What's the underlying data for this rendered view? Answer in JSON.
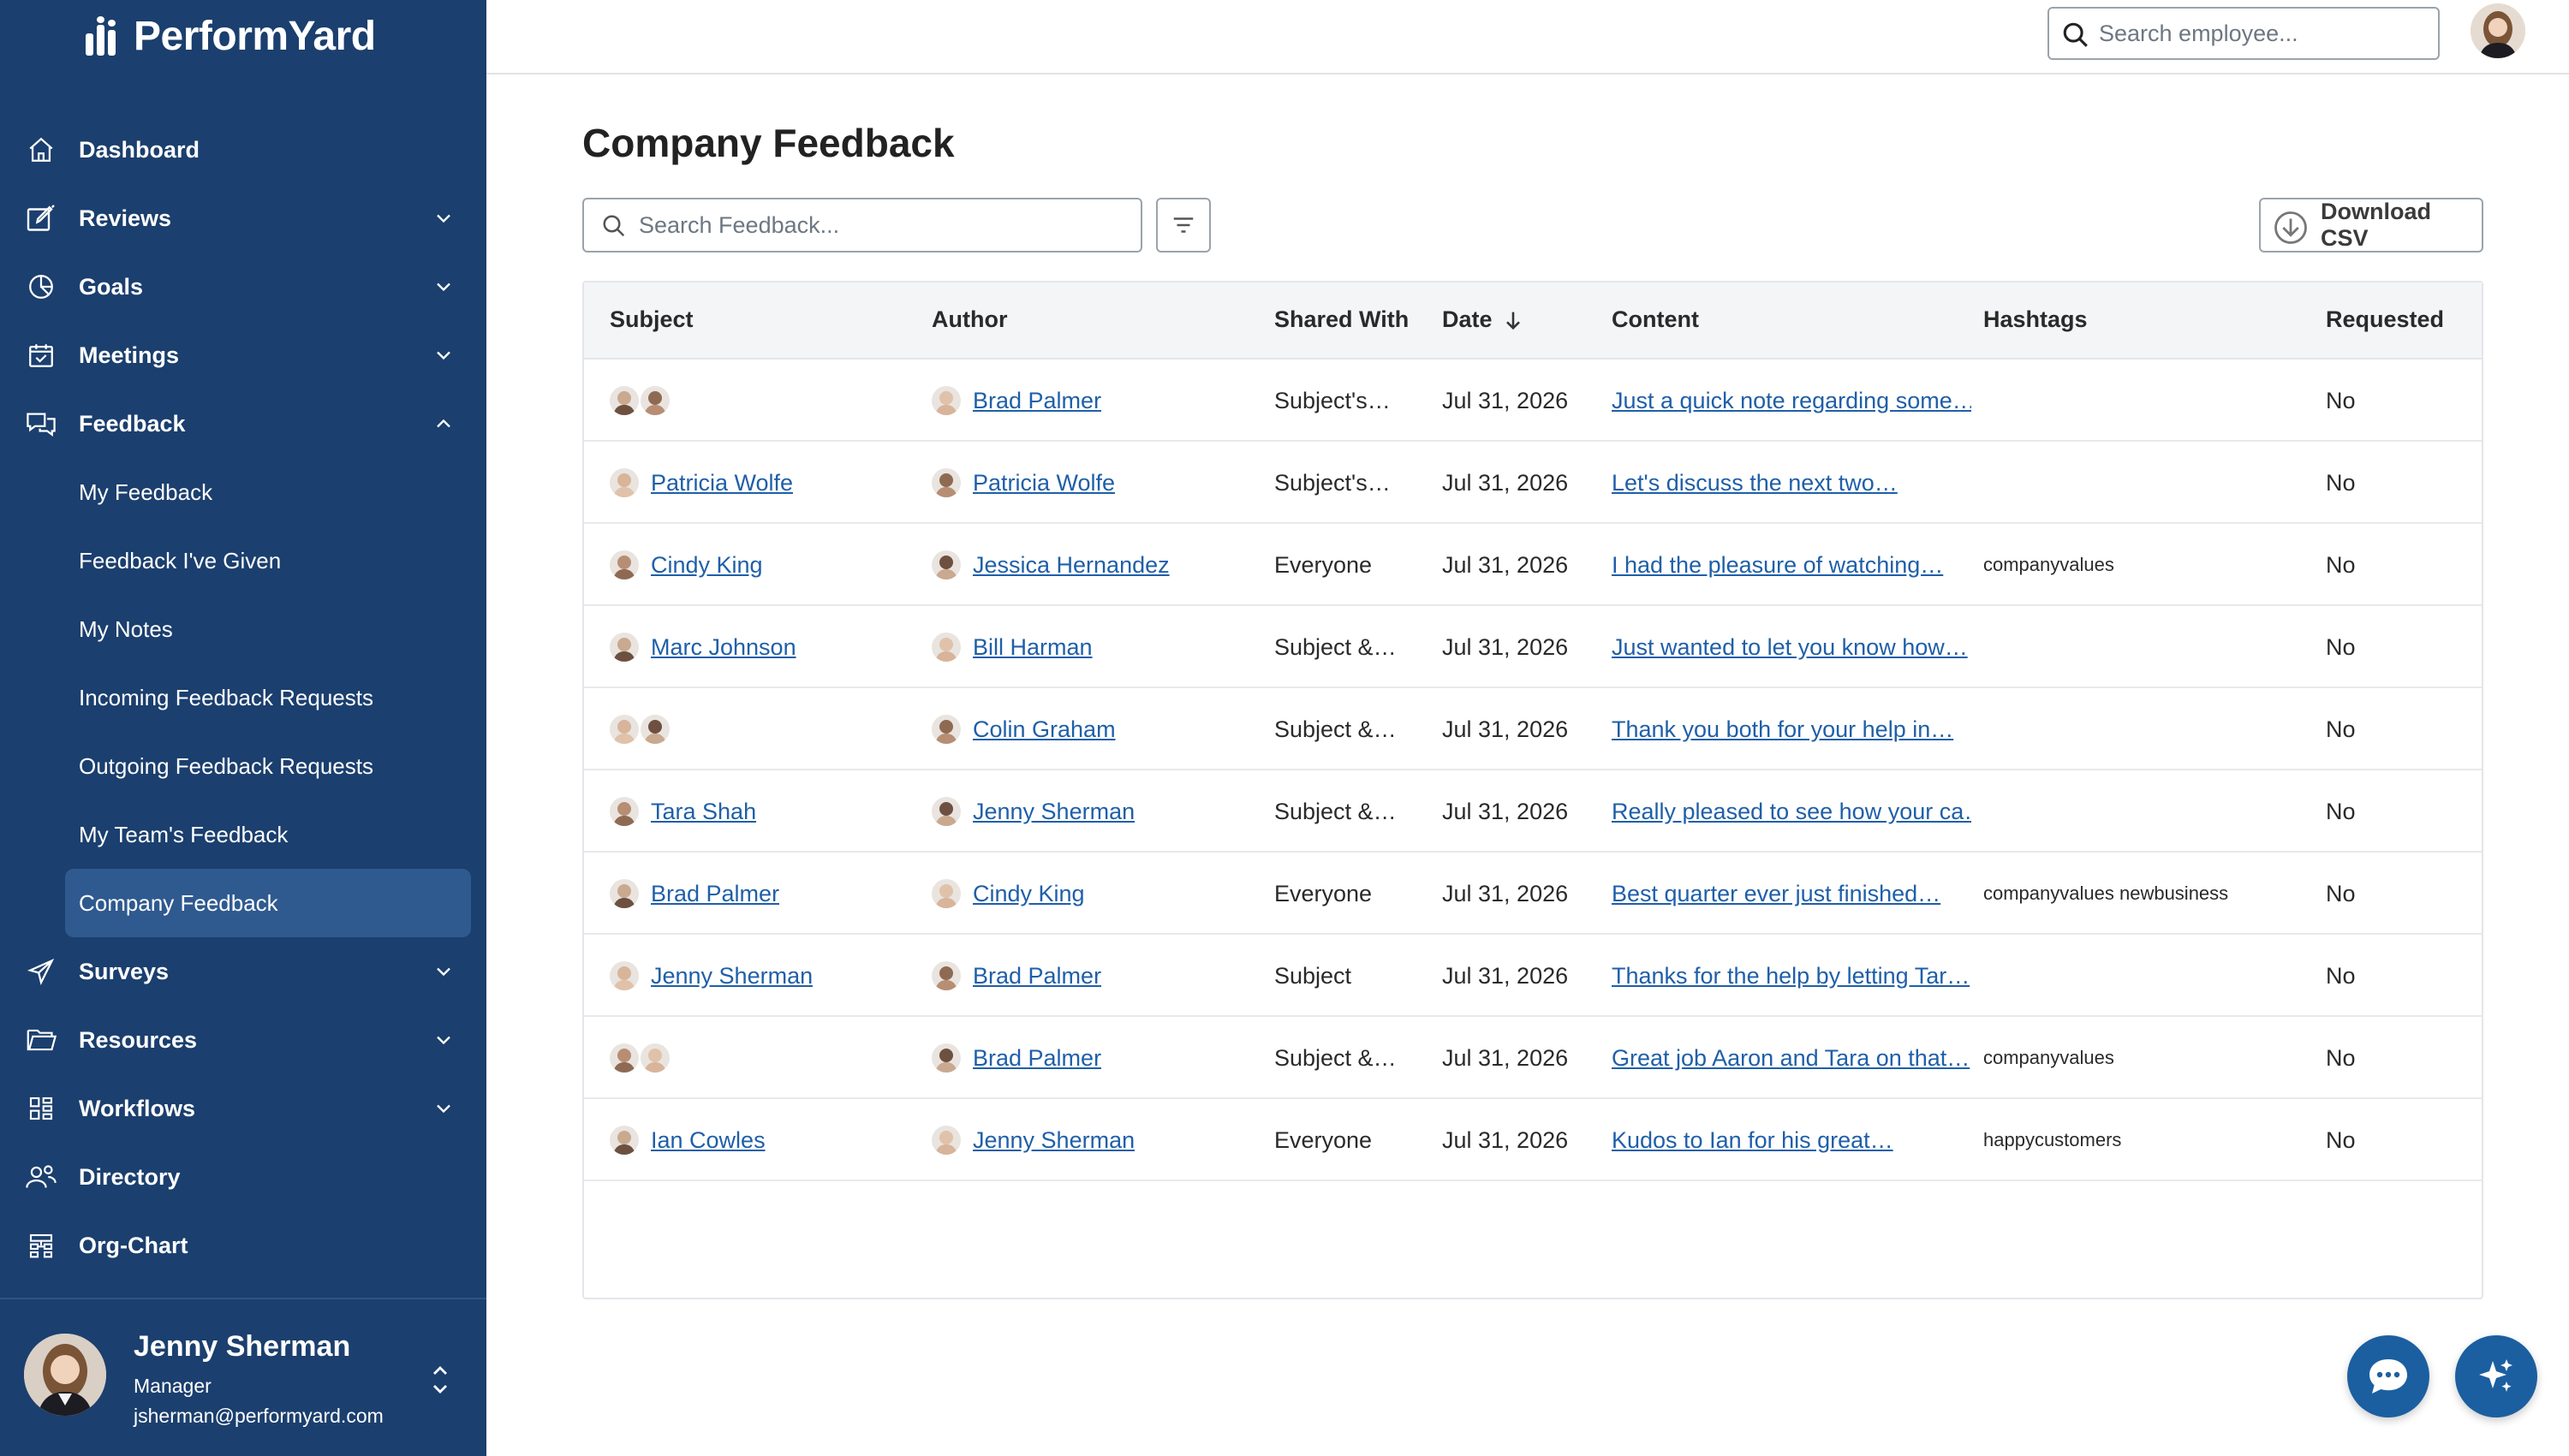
{
  "app": {
    "logo_text": "PerformYard"
  },
  "sidebar": {
    "items": [
      {
        "label": "Dashboard",
        "icon": "home-icon",
        "chevron": ""
      },
      {
        "label": "Reviews",
        "icon": "edit-icon",
        "chevron": "down"
      },
      {
        "label": "Goals",
        "icon": "pie-chart-icon",
        "chevron": "down"
      },
      {
        "label": "Meetings",
        "icon": "calendar-icon",
        "chevron": "down"
      },
      {
        "label": "Feedback",
        "icon": "chat-bubbles-icon",
        "chevron": "up"
      }
    ],
    "feedback_sub": [
      "My Feedback",
      "Feedback I've Given",
      "My Notes",
      "Incoming Feedback Requests",
      "Outgoing Feedback Requests",
      "My Team's Feedback",
      "Company Feedback"
    ],
    "items_after": [
      {
        "label": "Surveys",
        "icon": "send-icon",
        "chevron": "down"
      },
      {
        "label": "Resources",
        "icon": "folder-icon",
        "chevron": "down"
      },
      {
        "label": "Workflows",
        "icon": "grid-icon",
        "chevron": "down"
      },
      {
        "label": "Directory",
        "icon": "people-icon",
        "chevron": ""
      },
      {
        "label": "Org-Chart",
        "icon": "org-chart-icon",
        "chevron": ""
      }
    ],
    "active_sub": "Company Feedback"
  },
  "user": {
    "name": "Jenny Sherman",
    "role": "Manager",
    "email": "jsherman@performyard.com"
  },
  "header": {
    "search_placeholder": "Search employee..."
  },
  "main": {
    "title": "Company Feedback",
    "search_placeholder": "Search Feedback...",
    "download_label": "Download CSV",
    "columns": [
      "Subject",
      "Author",
      "Shared With",
      "Date",
      "Content",
      "Hashtags",
      "Requested"
    ],
    "rows": [
      {
        "subject": "",
        "subject_avatars": 2,
        "author": "Brad Palmer",
        "shared": "Subject's…",
        "date": "Jul 31, 2026",
        "content": "Just a quick note regarding some…",
        "tags": "",
        "requested": "No"
      },
      {
        "subject": "Patricia Wolfe",
        "subject_avatars": 1,
        "author": "Patricia Wolfe",
        "shared": "Subject's…",
        "date": "Jul 31, 2026",
        "content": "Let's discuss the next two…",
        "tags": "",
        "requested": "No"
      },
      {
        "subject": "Cindy King",
        "subject_avatars": 1,
        "author": "Jessica Hernandez",
        "shared": "Everyone",
        "date": "Jul 31, 2026",
        "content": "I had the pleasure of watching…",
        "tags": "companyvalues",
        "requested": "No"
      },
      {
        "subject": "Marc Johnson",
        "subject_avatars": 1,
        "author": "Bill Harman",
        "shared": "Subject &…",
        "date": "Jul 31, 2026",
        "content": "Just wanted to let you know how…",
        "tags": "",
        "requested": "No"
      },
      {
        "subject": "",
        "subject_avatars": 2,
        "author": "Colin Graham",
        "shared": "Subject &…",
        "date": "Jul 31, 2026",
        "content": "Thank you both for your help in…",
        "tags": "",
        "requested": "No"
      },
      {
        "subject": "Tara Shah",
        "subject_avatars": 1,
        "author": "Jenny Sherman",
        "shared": "Subject &…",
        "date": "Jul 31, 2026",
        "content": "Really pleased to see how your ca…",
        "tags": "",
        "requested": "No"
      },
      {
        "subject": "Brad Palmer",
        "subject_avatars": 1,
        "author": "Cindy King",
        "shared": "Everyone",
        "date": "Jul 31, 2026",
        "content": "Best quarter ever just finished…",
        "tags": "companyvalues newbusiness",
        "requested": "No"
      },
      {
        "subject": "Jenny Sherman",
        "subject_avatars": 1,
        "author": "Brad Palmer",
        "shared": "Subject",
        "date": "Jul 31, 2026",
        "content": "Thanks for the help by letting Tar…",
        "tags": "",
        "requested": "No"
      },
      {
        "subject": "",
        "subject_avatars": 2,
        "author": "Brad Palmer",
        "shared": "Subject &…",
        "date": "Jul 31, 2026",
        "content": "Great job Aaron and Tara on that…",
        "tags": "companyvalues",
        "requested": "No"
      },
      {
        "subject": "Ian Cowles",
        "subject_avatars": 1,
        "author": "Jenny Sherman",
        "shared": "Everyone",
        "date": "Jul 31, 2026",
        "content": "Kudos to Ian for his great…",
        "tags": "happycustomers",
        "requested": "No"
      }
    ]
  },
  "colors": {
    "sidebar": "#1b3f6e",
    "active": "#2f5a8f",
    "link": "#1f5fa8",
    "fab": "#1b5fa0"
  }
}
